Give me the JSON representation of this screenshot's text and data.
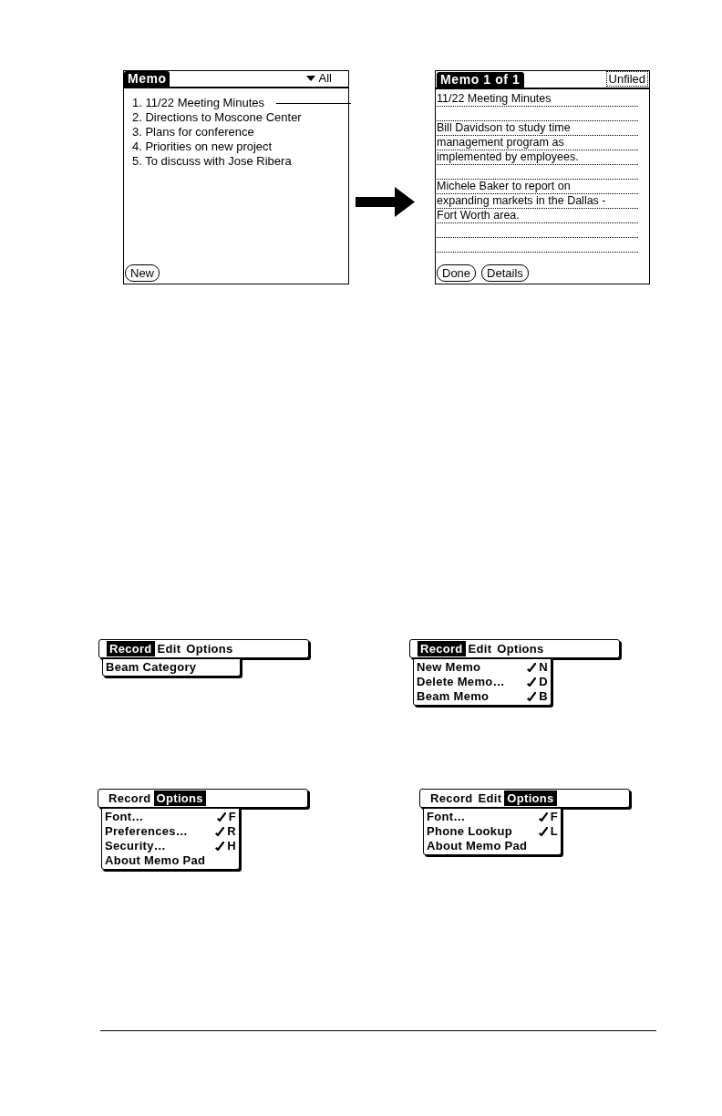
{
  "figure": {
    "list_screen": {
      "title": "Memo",
      "category": "All",
      "memos": [
        "1. 11/22 Meeting Minutes",
        "2. Directions to Moscone Center",
        "3. Plans for conference",
        "4. Priorities on new project",
        "5. To discuss with Jose Ribera"
      ],
      "buttons": [
        "New"
      ]
    },
    "memo_screen": {
      "title": "Memo 1 of 1",
      "category": "Unfiled",
      "paragraphs": [
        [
          "11/22 Meeting Minutes"
        ],
        [
          "Bill Davidson to study time",
          "management program as",
          "implemented by employees."
        ],
        [
          "Michele Baker to report on",
          "expanding markets in the Dallas -",
          "Fort Worth area."
        ]
      ],
      "buttons": [
        "Done",
        "Details"
      ]
    }
  },
  "menus": [
    {
      "menubar": [
        {
          "label": "Record",
          "selected": true
        },
        {
          "label": "Edit",
          "selected": false
        },
        {
          "label": "Options",
          "selected": false
        }
      ],
      "items": [
        {
          "label": "Beam Category"
        }
      ]
    },
    {
      "menubar": [
        {
          "label": "Record",
          "selected": true
        },
        {
          "label": "Edit",
          "selected": false
        },
        {
          "label": "Options",
          "selected": false
        }
      ],
      "items": [
        {
          "label": "New Memo",
          "shortcut": "N"
        },
        {
          "label": "Delete Memo…",
          "shortcut": "D"
        },
        {
          "label": "Beam Memo",
          "shortcut": "B"
        }
      ]
    },
    {
      "menubar": [
        {
          "label": "Record",
          "selected": false
        },
        {
          "label": "Options",
          "selected": true
        }
      ],
      "items": [
        {
          "label": "Font…",
          "shortcut": "F"
        },
        {
          "label": "Preferences…",
          "shortcut": "R"
        },
        {
          "label": "Security…",
          "shortcut": "H"
        },
        {
          "label": "About Memo Pad"
        }
      ]
    },
    {
      "menubar": [
        {
          "label": "Record",
          "selected": false
        },
        {
          "label": "Edit",
          "selected": false
        },
        {
          "label": "Options",
          "selected": true
        }
      ],
      "items": [
        {
          "label": "Font…",
          "shortcut": "F"
        },
        {
          "label": "Phone Lookup",
          "shortcut": "L"
        },
        {
          "label": "About Memo Pad"
        }
      ]
    }
  ]
}
